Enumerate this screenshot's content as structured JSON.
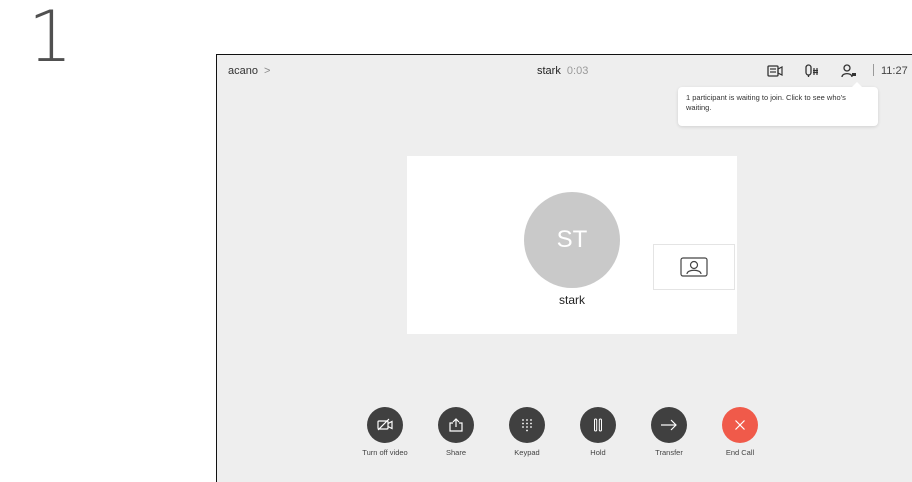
{
  "step": {
    "number": "1"
  },
  "topbar": {
    "brand": "acano",
    "brand_chevron": ">",
    "call_name": "stark",
    "call_timer": "0:03",
    "icons": [
      "screen-share-icon",
      "microphone-icon",
      "participants-icon"
    ],
    "clock": "11:27"
  },
  "tooltip": {
    "text": "1 participant is waiting to join. Click to see who's waiting."
  },
  "main": {
    "avatar_initials": "ST",
    "participant_name": "stark",
    "self_view_icon": "person-frame-icon"
  },
  "controls": [
    {
      "label": "Turn off video",
      "icon": "camera-off-icon"
    },
    {
      "label": "Share",
      "icon": "share-icon"
    },
    {
      "label": "Keypad",
      "icon": "keypad-icon"
    },
    {
      "label": "Hold",
      "icon": "pause-icon"
    },
    {
      "label": "Transfer",
      "icon": "arrow-right-icon"
    },
    {
      "label": "End Call",
      "icon": "close-icon"
    }
  ],
  "colors": {
    "background": "#eeeeee",
    "control_button": "#404040",
    "end_call": "#f05a4a",
    "avatar": "#c9c9c9"
  }
}
